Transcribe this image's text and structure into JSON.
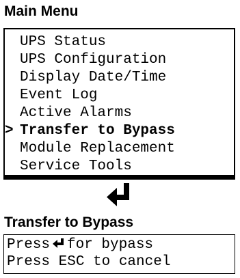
{
  "main_menu": {
    "title": "Main Menu",
    "cursor_symbol": ">",
    "items": [
      {
        "label": "UPS Status",
        "selected": false
      },
      {
        "label": "UPS Configuration",
        "selected": false
      },
      {
        "label": "Display Date/Time",
        "selected": false
      },
      {
        "label": "Event Log",
        "selected": false
      },
      {
        "label": "Active Alarms",
        "selected": false
      },
      {
        "label": "Transfer to Bypass",
        "selected": true
      },
      {
        "label": "Module Replacement",
        "selected": false
      },
      {
        "label": "Service Tools",
        "selected": false
      }
    ]
  },
  "enter_key_icon": "enter-key-icon",
  "bypass_screen": {
    "title": "Transfer to Bypass",
    "line1_prefix": "Press",
    "line1_suffix": "for bypass",
    "line2": "Press ESC to cancel"
  }
}
